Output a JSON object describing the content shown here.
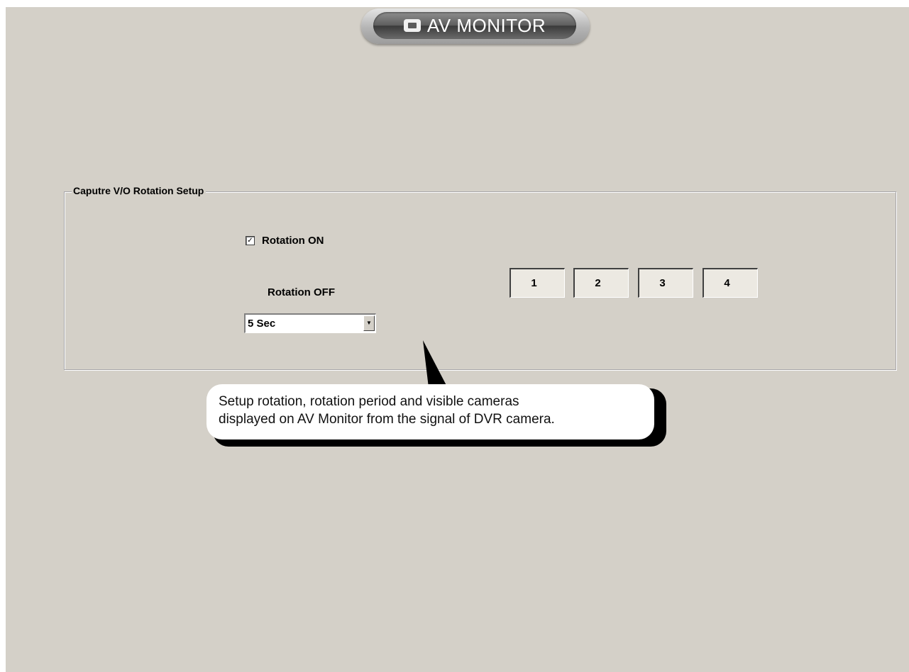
{
  "header": {
    "title": "AV MONITOR",
    "icon": "monitor-icon"
  },
  "group": {
    "title": "Caputre V/O Rotation Setup",
    "rotation_on": {
      "label": "Rotation ON",
      "checked": true,
      "check_glyph": "✓"
    },
    "rotation_off_label": "Rotation OFF",
    "period": {
      "selected": "5 Sec",
      "dropdown_icon": "chevron-down-icon",
      "arrow_glyph": "▼"
    },
    "cameras": [
      "1",
      "2",
      "3",
      "4"
    ]
  },
  "callout": {
    "line1": "Setup rotation, rotation period and visible cameras",
    "line2": "displayed on AV Monitor from the signal of DVR camera."
  },
  "colors": {
    "window_bg": "#d4d0c8",
    "title_text": "#ffffff"
  }
}
